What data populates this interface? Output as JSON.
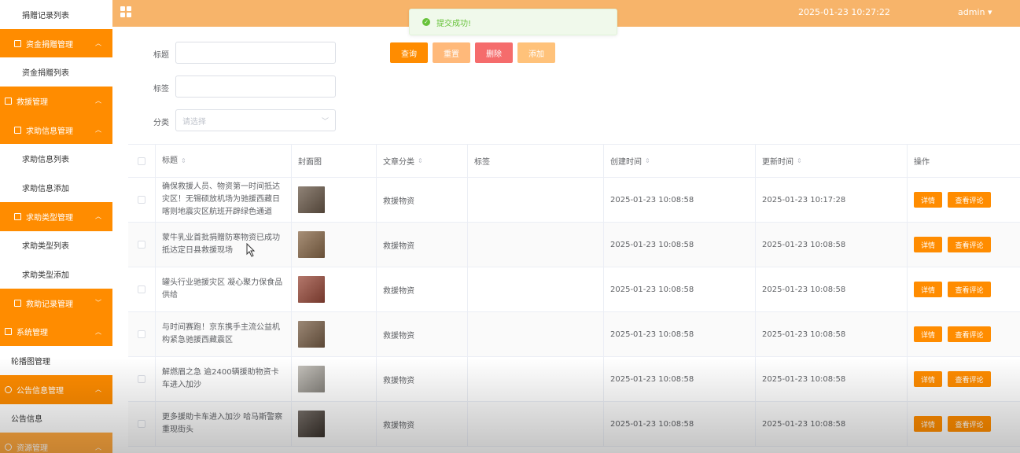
{
  "header": {
    "title": "",
    "datetime": "2025-01-23 10:27:22",
    "user": "admin"
  },
  "toast": {
    "message": "提交成功!"
  },
  "sidebar": {
    "items": [
      {
        "label": "捐赠记录列表",
        "type": "leaf"
      },
      {
        "label": "资金捐赠管理",
        "type": "group-sub",
        "chevron": "up"
      },
      {
        "label": "资金捐赠列表",
        "type": "leaf"
      },
      {
        "label": "救援管理",
        "type": "group",
        "chevron": "up"
      },
      {
        "label": "求助信息管理",
        "type": "group-sub",
        "chevron": "up"
      },
      {
        "label": "求助信息列表",
        "type": "leaf"
      },
      {
        "label": "求助信息添加",
        "type": "leaf"
      },
      {
        "label": "求助类型管理",
        "type": "group-sub",
        "chevron": "up"
      },
      {
        "label": "求助类型列表",
        "type": "leaf"
      },
      {
        "label": "求助类型添加",
        "type": "leaf"
      },
      {
        "label": "救助记录管理",
        "type": "group-sub",
        "chevron": "down"
      },
      {
        "label": "系统管理",
        "type": "group",
        "chevron": "up"
      },
      {
        "label": "轮播图管理",
        "type": "leaf-top"
      },
      {
        "label": "公告信息管理",
        "type": "group",
        "chevron": "up"
      },
      {
        "label": "公告信息",
        "type": "leaf-top"
      },
      {
        "label": "资源管理",
        "type": "group",
        "chevron": "up"
      }
    ]
  },
  "search": {
    "title_label": "标题",
    "tag_label": "标签",
    "category_label": "分类",
    "category_placeholder": "请选择"
  },
  "buttons": {
    "query": "查询",
    "reset": "重置",
    "delete": "删除",
    "add": "添加"
  },
  "colors": {
    "primary": "#ff8c00",
    "header": "#f7b46a",
    "reset": "#ffb97a",
    "delete": "#f56c6c",
    "add": "#ffc27a",
    "success": "#67c23a"
  },
  "table": {
    "headers": {
      "title": "标题",
      "cover": "封面图",
      "category": "文章分类",
      "tag": "标签",
      "created": "创建时间",
      "updated": "更新时间",
      "ops": "操作"
    },
    "op_detail": "详情",
    "op_comment": "查看评论",
    "rows": [
      {
        "title": "确保救援人员、物资第一时间抵达灾区！无锡硕放机场为驰援西藏日喀则地震灾区航班开辟绿色通道",
        "category": "救援物资",
        "tag": "",
        "created": "2025-01-23 10:08:58",
        "updated": "2025-01-23 10:17:28",
        "thumb_color": "#6b5a4a"
      },
      {
        "title": "蒙牛乳业首批捐赠防寒物资已成功抵达定日县救援现场",
        "category": "救援物资",
        "tag": "",
        "created": "2025-01-23 10:08:58",
        "updated": "2025-01-23 10:08:58",
        "thumb_color": "#8a6a4a"
      },
      {
        "title": "罐头行业驰援灾区 凝心聚力保食品供给",
        "category": "救援物资",
        "tag": "",
        "created": "2025-01-23 10:08:58",
        "updated": "2025-01-23 10:08:58",
        "thumb_color": "#9a4a3a"
      },
      {
        "title": "与时间赛跑！京东携手主流公益机构紧急驰援西藏震区",
        "category": "救援物资",
        "tag": "",
        "created": "2025-01-23 10:08:58",
        "updated": "2025-01-23 10:08:58",
        "thumb_color": "#7a6048"
      },
      {
        "title": "解燃眉之急 逾2400辆援助物资卡车进入加沙",
        "category": "救援物资",
        "tag": "",
        "created": "2025-01-23 10:08:58",
        "updated": "2025-01-23 10:08:58",
        "thumb_color": "#b0aca4"
      },
      {
        "title": "更多援助卡车进入加沙 哈马斯警察重现街头",
        "category": "救援物资",
        "tag": "",
        "created": "2025-01-23 10:08:58",
        "updated": "2025-01-23 10:08:58",
        "thumb_color": "#4a4038"
      }
    ]
  }
}
